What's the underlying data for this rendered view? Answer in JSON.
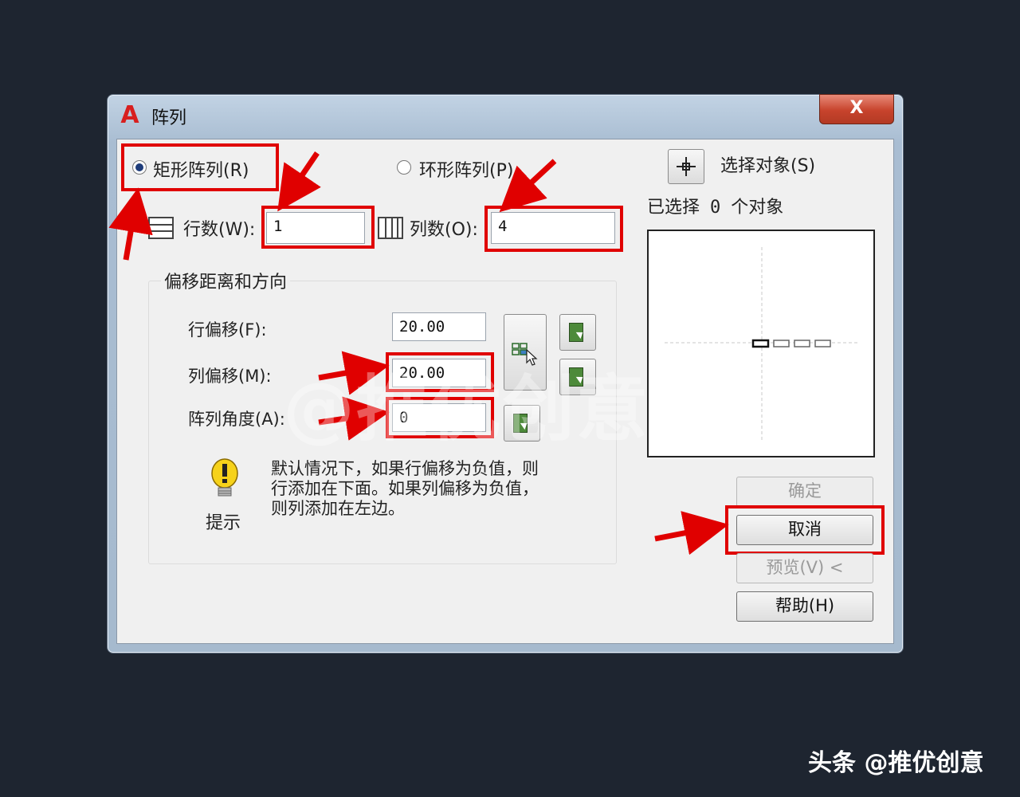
{
  "dialog": {
    "title": "阵列",
    "close_label": "X",
    "app_icon_letter": "A"
  },
  "mode": {
    "rect_label": "矩形阵列(R)",
    "polar_label": "环形阵列(P)",
    "selected": "rect"
  },
  "select_objects": {
    "button_label": "选择对象(S)",
    "selected_prefix": "已选择",
    "selected_count": "0",
    "selected_suffix": "个对象"
  },
  "grid": {
    "rows_label": "行数(W):",
    "rows_value": "1",
    "cols_label": "列数(O):",
    "cols_value": "4"
  },
  "offset": {
    "group_title": "偏移距离和方向",
    "row_offset_label": "行偏移(F):",
    "row_offset_value": "20.00",
    "col_offset_label": "列偏移(M):",
    "col_offset_value": "20.00",
    "angle_label": "阵列角度(A):",
    "angle_value": "0"
  },
  "tip": {
    "label": "提示",
    "line1": "默认情况下，如果行偏移为负值，则",
    "line2": "行添加在下面。如果列偏移为负值，",
    "line3": "则列添加在左边。"
  },
  "buttons": {
    "ok": "确定",
    "cancel": "取消",
    "preview": "预览(V) <",
    "help": "帮助(H)"
  },
  "watermark": "@推优创意",
  "footer": "头条 @推优创意",
  "colors": {
    "highlight_red": "#e00000",
    "background": "#1e2530"
  }
}
